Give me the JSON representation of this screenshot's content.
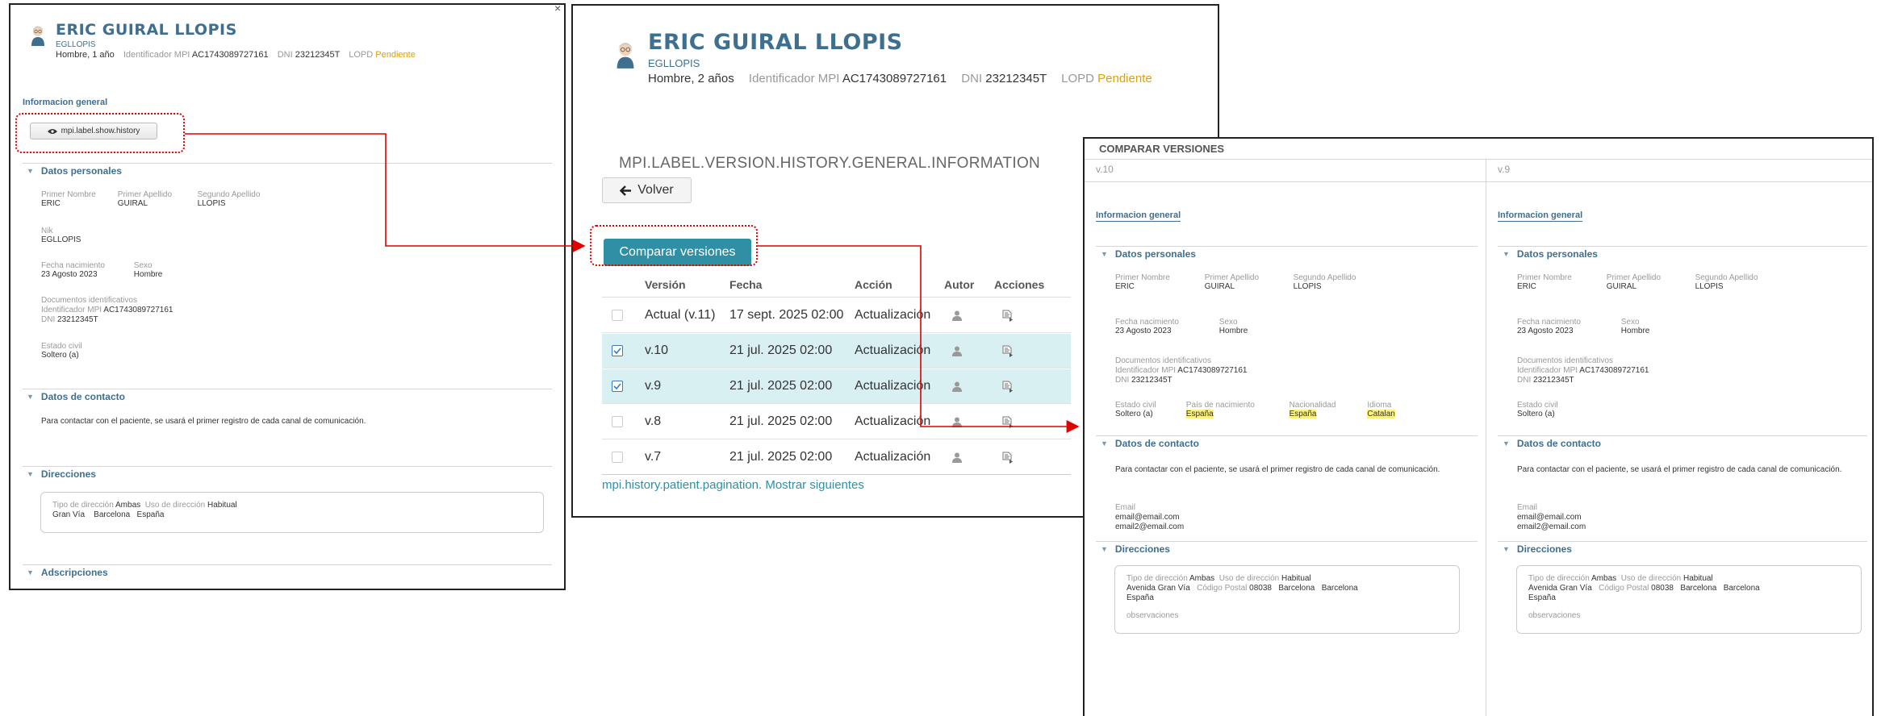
{
  "patient": {
    "name": "ERIC GUIRAL LLOPIS",
    "nik": "EGLLOPIS",
    "summary_w1": "Hombre, 1 año",
    "summary_w2": "Hombre, 2 años",
    "mpi_label": "Identificador MPI",
    "mpi_value": "AC1743089727161",
    "dni_label": "DNI",
    "dni_value": "23212345T",
    "lopd_label": "LOPD",
    "lopd_value": "Pendiente"
  },
  "window1": {
    "close_glyph": "×",
    "general_info": "Informacion general",
    "show_history_button": "mpi.label.show.history",
    "sections": {
      "personal": "Datos personales",
      "contact": "Datos de contacto",
      "addresses": "Direcciones",
      "subscriptions": "Adscripciones"
    },
    "personal": {
      "first_name_label": "Primer Nombre",
      "first_name": "ERIC",
      "first_surname_label": "Primer Apellido",
      "first_surname": "GUIRAL",
      "second_surname_label": "Segundo Apellido",
      "second_surname": "LLOPIS",
      "nik_label": "Nik",
      "nik": "EGLLOPIS",
      "birth_label": "Fecha nacimiento",
      "birth": "23 Agosto 2023",
      "sex_label": "Sexo",
      "sex": "Hombre",
      "docs_label": "Documentos identificativos",
      "mpi_label": "Identificador MPI",
      "mpi": "AC1743089727161",
      "dni_label": "DNI",
      "dni": "23212345T",
      "civil_label": "Estado civil",
      "civil": "Soltero (a)"
    },
    "contact_text": "Para contactar con el paciente, se usará el primer registro de cada canal de comunicación.",
    "address": {
      "type_label": "Tipo de dirección",
      "type": "Ambas",
      "use_label": "Uso de dirección",
      "use": "Habitual",
      "street": "Gran Vía",
      "city": "Barcelona",
      "country": "España"
    }
  },
  "window2": {
    "history_title": "MPI.LABEL.VERSION.HISTORY.GENERAL.INFORMATION",
    "back_button": "Volver",
    "back_icon": "arrow-left",
    "compare_button": "Comparar versiones",
    "columns": [
      "Versión",
      "Fecha",
      "Acción",
      "Autor",
      "Acciones"
    ],
    "rows": [
      {
        "version": "Actual (v.11)",
        "date": "17 sept. 2025 02:00",
        "action": "Actualización",
        "checked": false
      },
      {
        "version": "v.10",
        "date": "21 jul. 2025 02:00",
        "action": "Actualización",
        "checked": true
      },
      {
        "version": "v.9",
        "date": "21 jul. 2025 02:00",
        "action": "Actualización",
        "checked": true
      },
      {
        "version": "v.8",
        "date": "21 jul. 2025 02:00",
        "action": "Actualización",
        "checked": false
      },
      {
        "version": "v.7",
        "date": "21 jul. 2025 02:00",
        "action": "Actualización",
        "checked": false
      }
    ],
    "pagination_text": "mpi.history.patient.pagination.",
    "show_more_link": "Mostrar siguientes"
  },
  "window3": {
    "title": "COMPARAR VERSIONES",
    "columns": [
      {
        "version": "v.10",
        "general_info": "Informacion general",
        "sections": {
          "personal": "Datos personales",
          "contact": "Datos de contacto",
          "addresses": "Direcciones"
        },
        "first_name_label": "Primer Nombre",
        "first_name": "ERIC",
        "first_surname_label": "Primer Apellido",
        "first_surname": "GUIRAL",
        "second_surname_label": "Segundo Apellido",
        "second_surname": "LLOPIS",
        "birth_label": "Fecha nacimiento",
        "birth": "23 Agosto 2023",
        "sex_label": "Sexo",
        "sex": "Hombre",
        "docs_label": "Documentos identificativos",
        "mpi_label": "Identificador MPI",
        "mpi": "AC1743089727161",
        "dni_label": "DNI",
        "dni": "23212345T",
        "civil_label": "Estado civil",
        "civil": "Soltero (a)",
        "birth_country_label": "País de nacimiento",
        "birth_country": "España",
        "nationality_label": "Nacionalidad",
        "nationality": "España",
        "language_label": "Idioma",
        "language": "Catalan",
        "contact_text": "Para contactar con el paciente, se usará el primer registro de cada canal de comunicación.",
        "email_label": "Email",
        "email1": "email@email.com",
        "email2": "email2@email.com",
        "addr_type_label": "Tipo de dirección",
        "addr_type": "Ambas",
        "addr_use_label": "Uso de dirección",
        "addr_use": "Habitual",
        "street": "Avenida Gran Vía",
        "postal_label": "Código Postal",
        "postal": "08038",
        "city1": "Barcelona",
        "city2": "Barcelona",
        "country": "España",
        "observations": "observaciones"
      },
      {
        "version": "v.9",
        "general_info": "Informacion general",
        "sections": {
          "personal": "Datos personales",
          "contact": "Datos de contacto",
          "addresses": "Direcciones"
        },
        "first_name_label": "Primer Nombre",
        "first_name": "ERIC",
        "first_surname_label": "Primer Apellido",
        "first_surname": "GUIRAL",
        "second_surname_label": "Segundo Apellido",
        "second_surname": "LLOPIS",
        "birth_label": "Fecha nacimiento",
        "birth": "23 Agosto 2023",
        "sex_label": "Sexo",
        "sex": "Hombre",
        "docs_label": "Documentos identificativos",
        "mpi_label": "Identificador MPI",
        "mpi": "AC1743089727161",
        "dni_label": "DNI",
        "dni": "23212345T",
        "civil_label": "Estado civil",
        "civil": "Soltero (a)",
        "contact_text": "Para contactar con el paciente, se usará el primer registro de cada canal de comunicación.",
        "email_label": "Email",
        "email1": "email@email.com",
        "email2": "email2@email.com",
        "addr_type_label": "Tipo de dirección",
        "addr_type": "Ambas",
        "addr_use_label": "Uso de dirección",
        "addr_use": "Habitual",
        "street": "Avenida Gran Vía",
        "postal_label": "Código Postal",
        "postal": "08038",
        "city1": "Barcelona",
        "city2": "Barcelona",
        "country": "España",
        "observations": "observaciones"
      }
    ]
  },
  "colors": {
    "brand_blue": "#3f6f8f",
    "teal_button": "#2e8fa5",
    "row_highlight": "#d9f0f2",
    "annotation_red": "#e00000",
    "pending_amber": "#e0a000",
    "diff_highlight": "#fff27a"
  }
}
